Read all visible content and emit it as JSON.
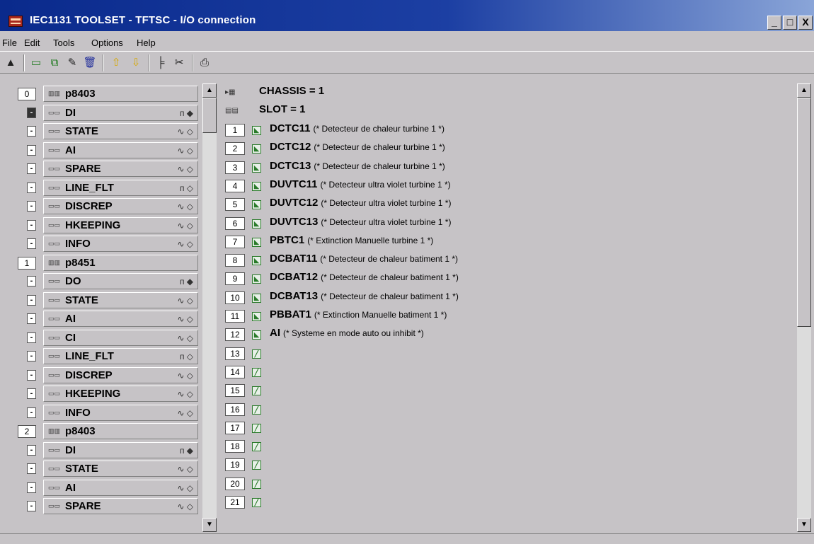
{
  "window": {
    "title": "IEC1131 TOOLSET - TFTSC - I/O connection",
    "buttons": [
      "_",
      "□",
      "X"
    ]
  },
  "menu": [
    "File",
    "Edit",
    "Tools",
    "Options",
    "Help"
  ],
  "toolbar": {
    "icons": [
      "open-icon",
      "module-icon",
      "copy-module-icon",
      "edit-module-icon",
      "delete-icon",
      "move-up-icon",
      "move-down-icon",
      "tree-icon",
      "cut-icon",
      "print-icon"
    ]
  },
  "tree": {
    "rows": [
      {
        "kind": "module",
        "num": "0",
        "label": "p8403",
        "status": ""
      },
      {
        "kind": "sub",
        "collapse": "-",
        "selected": true,
        "label": "DI",
        "status": "ᴨ ◆"
      },
      {
        "kind": "sub",
        "collapse": "-",
        "label": "STATE",
        "status": "∿ ◇"
      },
      {
        "kind": "sub",
        "collapse": "-",
        "label": "AI",
        "status": "∿ ◇"
      },
      {
        "kind": "sub",
        "collapse": "-",
        "label": "SPARE",
        "status": "∿ ◇"
      },
      {
        "kind": "sub",
        "collapse": "-",
        "label": "LINE_FLT",
        "status": "ᴨ ◇"
      },
      {
        "kind": "sub",
        "collapse": "-",
        "label": "DISCREP",
        "status": "∿ ◇"
      },
      {
        "kind": "sub",
        "collapse": "-",
        "label": "HKEEPING",
        "status": "∿ ◇"
      },
      {
        "kind": "sub",
        "collapse": "-",
        "label": "INFO",
        "status": "∿ ◇"
      },
      {
        "kind": "module",
        "num": "1",
        "label": "p8451",
        "status": ""
      },
      {
        "kind": "sub",
        "collapse": "-",
        "label": "DO",
        "status": "ᴨ ◆"
      },
      {
        "kind": "sub",
        "collapse": "-",
        "label": "STATE",
        "status": "∿ ◇"
      },
      {
        "kind": "sub",
        "collapse": "-",
        "label": "AI",
        "status": "∿ ◇"
      },
      {
        "kind": "sub",
        "collapse": "-",
        "label": "CI",
        "status": "∿ ◇"
      },
      {
        "kind": "sub",
        "collapse": "-",
        "label": "LINE_FLT",
        "status": "ᴨ ◇"
      },
      {
        "kind": "sub",
        "collapse": "-",
        "label": "DISCREP",
        "status": "∿ ◇"
      },
      {
        "kind": "sub",
        "collapse": "-",
        "label": "HKEEPING",
        "status": "∿ ◇"
      },
      {
        "kind": "sub",
        "collapse": "-",
        "label": "INFO",
        "status": "∿ ◇"
      },
      {
        "kind": "module",
        "num": "2",
        "label": "p8403",
        "status": ""
      },
      {
        "kind": "sub",
        "collapse": "-",
        "label": "DI",
        "status": "ᴨ ◆"
      },
      {
        "kind": "sub",
        "collapse": "-",
        "label": "STATE",
        "status": "∿ ◇"
      },
      {
        "kind": "sub",
        "collapse": "-",
        "label": "AI",
        "status": "∿ ◇"
      },
      {
        "kind": "sub",
        "collapse": "-",
        "label": "SPARE",
        "status": "∿ ◇"
      }
    ]
  },
  "io": {
    "chassis": "CHASSIS = 1",
    "slot": "SLOT = 1",
    "rows": [
      {
        "num": "1",
        "name": "DCTC11",
        "comment": "(* Detecteur de chaleur turbine 1 *)"
      },
      {
        "num": "2",
        "name": "DCTC12",
        "comment": "(* Detecteur de chaleur turbine 1 *)"
      },
      {
        "num": "3",
        "name": "DCTC13",
        "comment": "(* Detecteur de chaleur turbine 1 *)"
      },
      {
        "num": "4",
        "name": "DUVTC11",
        "comment": "(* Detecteur ultra violet turbine 1 *)"
      },
      {
        "num": "5",
        "name": "DUVTC12",
        "comment": "(* Detecteur ultra violet turbine 1 *)"
      },
      {
        "num": "6",
        "name": "DUVTC13",
        "comment": "(* Detecteur ultra violet turbine 1 *)"
      },
      {
        "num": "7",
        "name": "PBTC1",
        "comment": "(* Extinction Manuelle turbine 1 *)"
      },
      {
        "num": "8",
        "name": "DCBAT11",
        "comment": "(* Detecteur de chaleur batiment 1 *)"
      },
      {
        "num": "9",
        "name": "DCBAT12",
        "comment": "(* Detecteur de chaleur batiment 1 *)"
      },
      {
        "num": "10",
        "name": "DCBAT13",
        "comment": "(* Detecteur de chaleur batiment 1 *)"
      },
      {
        "num": "11",
        "name": "PBBAT1",
        "comment": "(* Extinction Manuelle batiment 1 *)"
      },
      {
        "num": "12",
        "name": "AI",
        "comment": "(* Systeme en mode auto ou inhibit *)"
      },
      {
        "num": "13",
        "name": "",
        "comment": ""
      },
      {
        "num": "14",
        "name": "",
        "comment": ""
      },
      {
        "num": "15",
        "name": "",
        "comment": ""
      },
      {
        "num": "16",
        "name": "",
        "comment": ""
      },
      {
        "num": "17",
        "name": "",
        "comment": ""
      },
      {
        "num": "18",
        "name": "",
        "comment": ""
      },
      {
        "num": "19",
        "name": "",
        "comment": ""
      },
      {
        "num": "20",
        "name": "",
        "comment": ""
      },
      {
        "num": "21",
        "name": "",
        "comment": ""
      }
    ]
  },
  "colors": {
    "titlebar": "#0a2a8c",
    "window_bg": "#c6c3c6",
    "io_icon": "#2a7a2a"
  }
}
